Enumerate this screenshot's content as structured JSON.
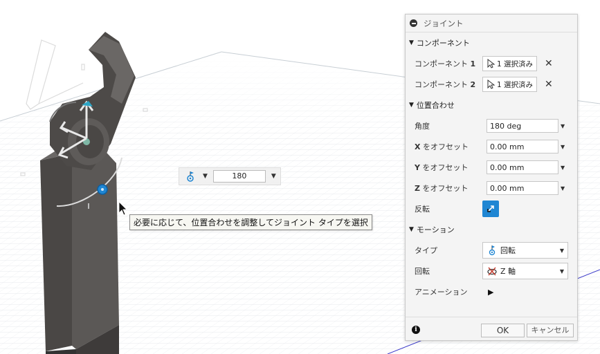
{
  "viewport": {
    "angle_input": {
      "value": "180"
    },
    "tooltip": "必要に応じて、位置合わせを調整してジョイント タイプを選択"
  },
  "panel": {
    "title": "ジョイント",
    "sections": {
      "component": "コンポーネント",
      "alignment": "位置合わせ",
      "motion": "モーション"
    },
    "component1": {
      "label": "コンポーネント",
      "num": "1",
      "button": "1 選択済み"
    },
    "component2": {
      "label": "コンポーネント",
      "num": "2",
      "button": "1 選択済み"
    },
    "angle": {
      "label": "角度",
      "value": "180 deg"
    },
    "x_offset": {
      "axis": "X",
      "label": " をオフセット",
      "value": "0.00 mm"
    },
    "y_offset": {
      "axis": "Y",
      "label": " をオフセット",
      "value": "0.00 mm"
    },
    "z_offset": {
      "axis": "Z",
      "label": " をオフセット",
      "value": "0.00 mm"
    },
    "flip": {
      "label": "反転"
    },
    "type": {
      "label": "タイプ",
      "value": "回転"
    },
    "rotation": {
      "label": "回転",
      "value": "Z 軸"
    },
    "animation": {
      "label": "アニメーション"
    },
    "ok": "OK",
    "cancel": "キャンセル"
  },
  "colors": {
    "accent": "#1f86d3",
    "part": "#4a4745",
    "grid": "#cfd6dc"
  }
}
